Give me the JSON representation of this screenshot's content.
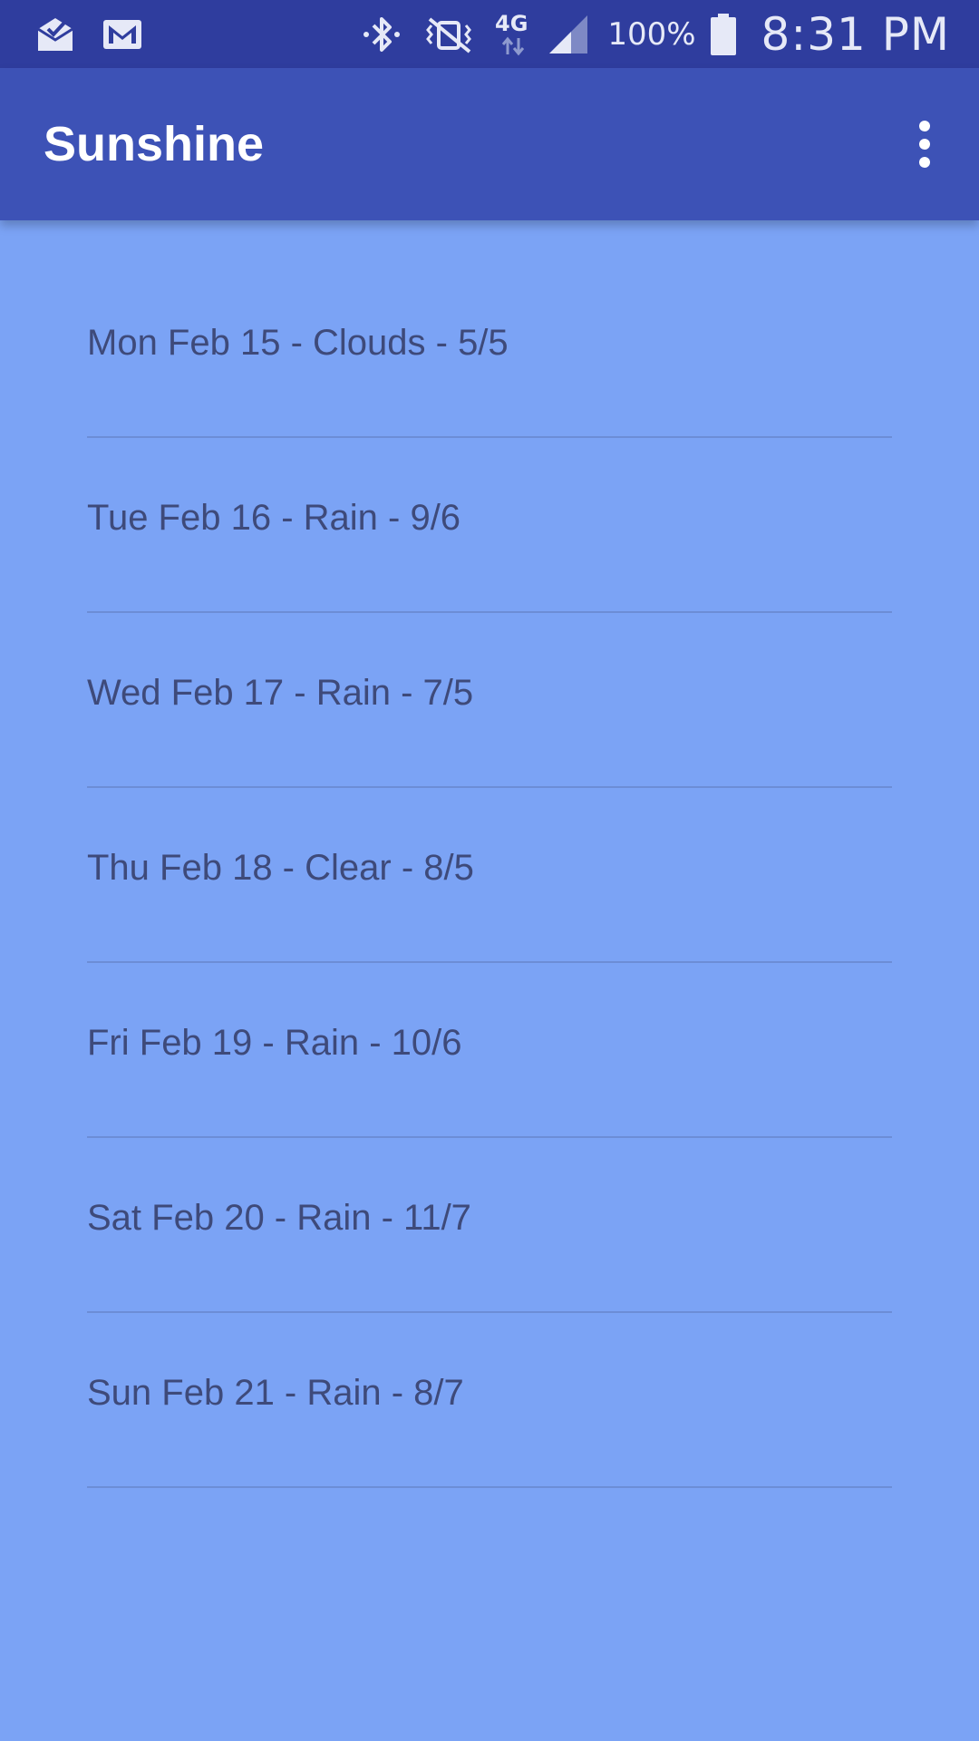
{
  "status_bar": {
    "battery_percent": "100%",
    "time": "8:31 PM",
    "network_label": "4G"
  },
  "toolbar": {
    "title": "Sunshine"
  },
  "forecast": [
    "Mon Feb 15 - Clouds - 5/5",
    "Tue Feb 16 - Rain - 9/6",
    "Wed Feb 17 - Rain - 7/5",
    "Thu Feb 18 - Clear - 8/5",
    "Fri Feb 19 - Rain - 10/6",
    "Sat Feb 20 - Rain - 11/7",
    "Sun Feb 21 - Rain - 8/7"
  ],
  "colors": {
    "status_bar": "#2F3D9E",
    "toolbar": "#3D52B6",
    "background": "#7BA3F5",
    "item_text": "#3E4A7A",
    "divider": "#6C8DD6"
  }
}
